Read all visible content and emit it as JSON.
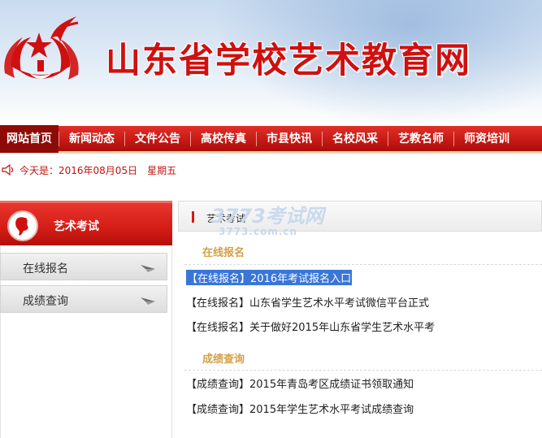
{
  "header": {
    "site_title": "山东省学校艺术教育网"
  },
  "nav": {
    "items": [
      {
        "label": "网站首页",
        "active": true
      },
      {
        "label": "新闻动态"
      },
      {
        "label": "文件公告"
      },
      {
        "label": "高校传真"
      },
      {
        "label": "市县快讯"
      },
      {
        "label": "名校风采"
      },
      {
        "label": "艺教名师"
      },
      {
        "label": "师资培训"
      }
    ]
  },
  "dateline": {
    "text": "今天是：2016年08月05日　星期五"
  },
  "sidebar": {
    "category_title": "艺术考试",
    "items": [
      {
        "label": "在线报名"
      },
      {
        "label": "成绩查询"
      }
    ]
  },
  "main": {
    "panel_title": "艺术考试",
    "watermark": "3773考试网",
    "watermark_sub": "3773.com.cn",
    "sections": [
      {
        "title": "在线报名",
        "links": [
          {
            "text": "【在线报名】2016年考试报名入口",
            "selected": true
          },
          {
            "text": "【在线报名】山东省学生艺术水平考试微信平台正式"
          },
          {
            "text": "【在线报名】关于做好2015年山东省学生艺术水平考"
          }
        ]
      },
      {
        "title": "成绩查询",
        "links": [
          {
            "text": "【成绩查询】2015年青岛考区成绩证书领取通知"
          },
          {
            "text": "【成绩查询】2015年学生艺术水平考试成绩查询"
          }
        ]
      }
    ]
  },
  "colors": {
    "brand_red": "#c81914",
    "section_gold": "#d4a048",
    "selection_blue": "#3a76d8"
  }
}
